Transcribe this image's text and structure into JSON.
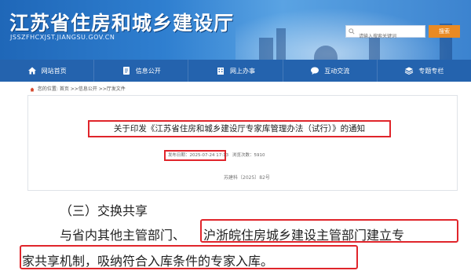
{
  "header": {
    "site_title": "江苏省住房和城乡建设厅",
    "site_domain": "JSSZFHCXJST.JIANGSU.GOV.CN",
    "search_placeholder": "请输入搜索关键词",
    "search_button": "搜索"
  },
  "nav": {
    "items": [
      {
        "label": "网站首页",
        "icon": "home-icon"
      },
      {
        "label": "信息公开",
        "icon": "document-icon"
      },
      {
        "label": "网上办事",
        "icon": "building-icon"
      },
      {
        "label": "互动交流",
        "icon": "chat-icon"
      },
      {
        "label": "专题专栏",
        "icon": "layers-icon"
      }
    ]
  },
  "breadcrumb": "您的位置: 首页 >>信息公开 >>厅发文件",
  "article": {
    "title": "关于印发《江苏省住房和城乡建设厅专家库管理办法（试行）》的通知",
    "publish_date": "发布日期：2025-07-24 17:13",
    "views": "浏览次数：5910",
    "doc_number": "苏建科〔2025〕82号"
  },
  "excerpt": {
    "heading": "（三）交换共享",
    "line1_prefix": "与省内其他主管部门、",
    "line1_highlight": "沪浙皖住房城乡建设主管部门建立专",
    "line2_highlight": "家共享机制，吸纳符合入库条件的专家入库。"
  },
  "colors": {
    "nav_bg": "#2463ae",
    "highlight_border": "#e0252b",
    "search_button": "#e98a23"
  }
}
